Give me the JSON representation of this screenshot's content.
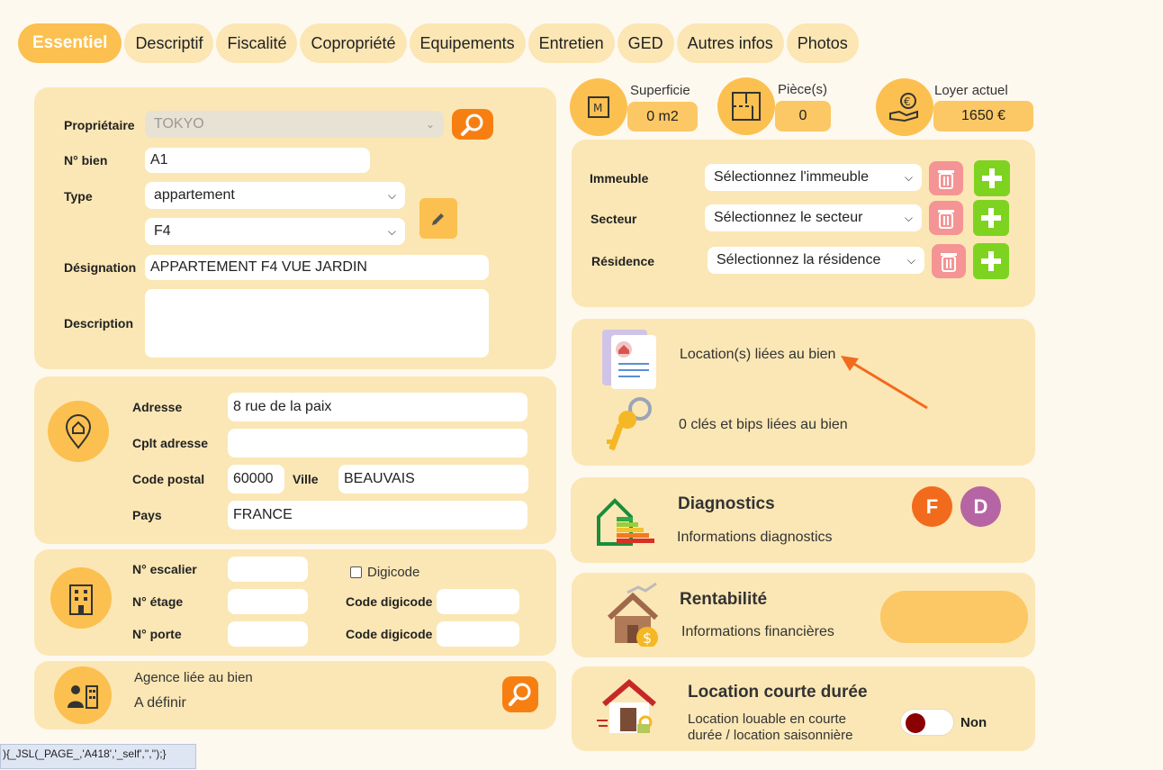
{
  "tabs": [
    "Essentiel",
    "Descriptif",
    "Fiscalité",
    "Copropriété",
    "Equipements",
    "Entretien",
    "GED",
    "Autres infos",
    "Photos"
  ],
  "general": {
    "owner_label": "Propriétaire",
    "owner_value": "TOKYO",
    "nbien_label": "N° bien",
    "nbien_value": "A1",
    "type_label": "Type",
    "type_value": "appartement",
    "subtype_value": "F4",
    "designation_label": "Désignation",
    "designation_value": "APPARTEMENT F4 VUE JARDIN",
    "description_label": "Description",
    "description_value": ""
  },
  "address": {
    "adresse_label": "Adresse",
    "adresse_value": "8  rue de la paix",
    "cplt_label": "Cplt adresse",
    "cplt_value": "",
    "cp_label": "Code postal",
    "cp_value": "60000",
    "ville_label": "Ville",
    "ville_value": "BEAUVAIS",
    "pays_label": "Pays",
    "pays_value": "FRANCE"
  },
  "building": {
    "escalier_label": "N° escalier",
    "escalier_value": "",
    "etage_label": "N° étage",
    "etage_value": "",
    "porte_label": "N° porte",
    "porte_value": "",
    "digicode_label": "Digicode",
    "code1_label": "Code digicode",
    "code1_value": "",
    "code2_label": "Code digicode",
    "code2_value": ""
  },
  "agency": {
    "title": "Agence liée au bien",
    "value": "A définir"
  },
  "status_text": "){_JSL(_PAGE_,'A418','_self','','');}",
  "stats": {
    "superficie_label": "Superficie",
    "superficie_value": "0 m2",
    "pieces_label": "Pièce(s)",
    "pieces_value": "0",
    "loyer_label": "Loyer actuel",
    "loyer_value": "1650 €"
  },
  "links": {
    "immeuble_label": "Immeuble",
    "immeuble_value": "Sélectionnez l'immeuble",
    "secteur_label": "Secteur",
    "secteur_value": "Sélectionnez le secteur",
    "residence_label": "Résidence",
    "residence_value": "Sélectionnez la résidence"
  },
  "locations": {
    "loc_text": "Location(s) liées au bien",
    "keys_text": "0 clés et bips liées au bien"
  },
  "diagnostics": {
    "title": "Diagnostics",
    "subtitle": "Informations diagnostics",
    "badge1": "F",
    "badge2": "D",
    "badge1_color": "#f26b1d",
    "badge2_color": "#b665a4"
  },
  "rentabilite": {
    "title": "Rentabilité",
    "subtitle": "Informations financières"
  },
  "courte": {
    "title": "Location courte durée",
    "line1": "Location louable en courte",
    "line2": "durée / location saisonnière",
    "toggle_label": "Non"
  },
  "colors": {
    "panel": "#fbe7b5",
    "accent": "#fbc04f",
    "orange": "#f77f12",
    "green": "#7ed321",
    "red": "#f59494"
  }
}
